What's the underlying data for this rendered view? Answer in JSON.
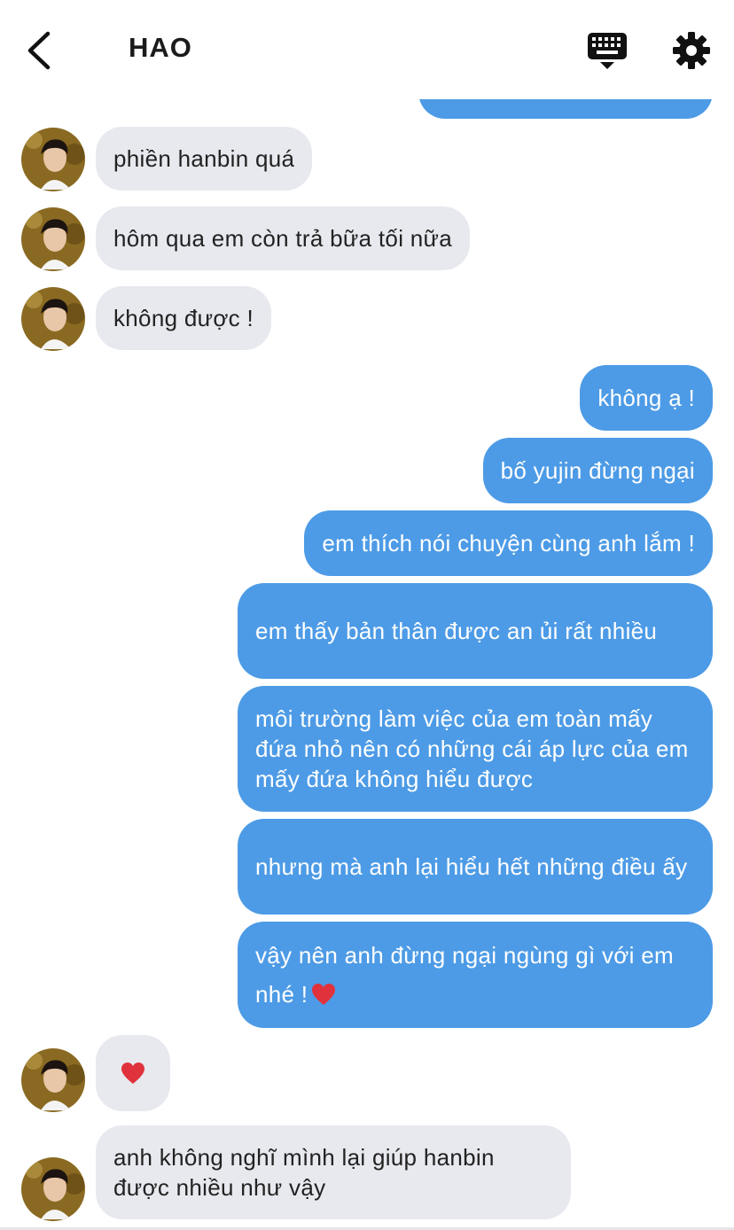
{
  "header": {
    "title": "HAO",
    "back_icon": "chevron-left-icon",
    "keyboard_icon": "keyboard-icon",
    "settings_icon": "gear-icon"
  },
  "colors": {
    "sent_bubble": "#4d9be6",
    "received_bubble": "#e8e9ee",
    "heart": "#e0323c"
  },
  "messages": [
    {
      "from": "received",
      "text": "phiền hanbin quá"
    },
    {
      "from": "received",
      "text": "hôm qua em còn trả bữa tối nữa"
    },
    {
      "from": "received",
      "text": "không được !"
    },
    {
      "from": "sent",
      "text": "không ạ !"
    },
    {
      "from": "sent",
      "text": "bố yujin đừng ngại"
    },
    {
      "from": "sent",
      "text": "em thích nói chuyện cùng anh lắm !"
    },
    {
      "from": "sent",
      "text": "em thấy bản thân được an ủi rất nhiều"
    },
    {
      "from": "sent",
      "text": "môi trường làm việc của em toàn mấy đứa nhỏ nên có những cái áp lực của em mấy đứa không hiểu được"
    },
    {
      "from": "sent",
      "text": "nhưng mà anh lại hiểu hết những điều ấy"
    },
    {
      "from": "sent",
      "text": "vậy nên anh đừng ngại ngùng gì với em nhé !",
      "emoji": "heart-emoji"
    },
    {
      "from": "received",
      "text": "",
      "emoji": "heart-emoji"
    },
    {
      "from": "received",
      "text": "anh không nghĩ mình lại giúp hanbin được nhiều như vậy"
    }
  ]
}
